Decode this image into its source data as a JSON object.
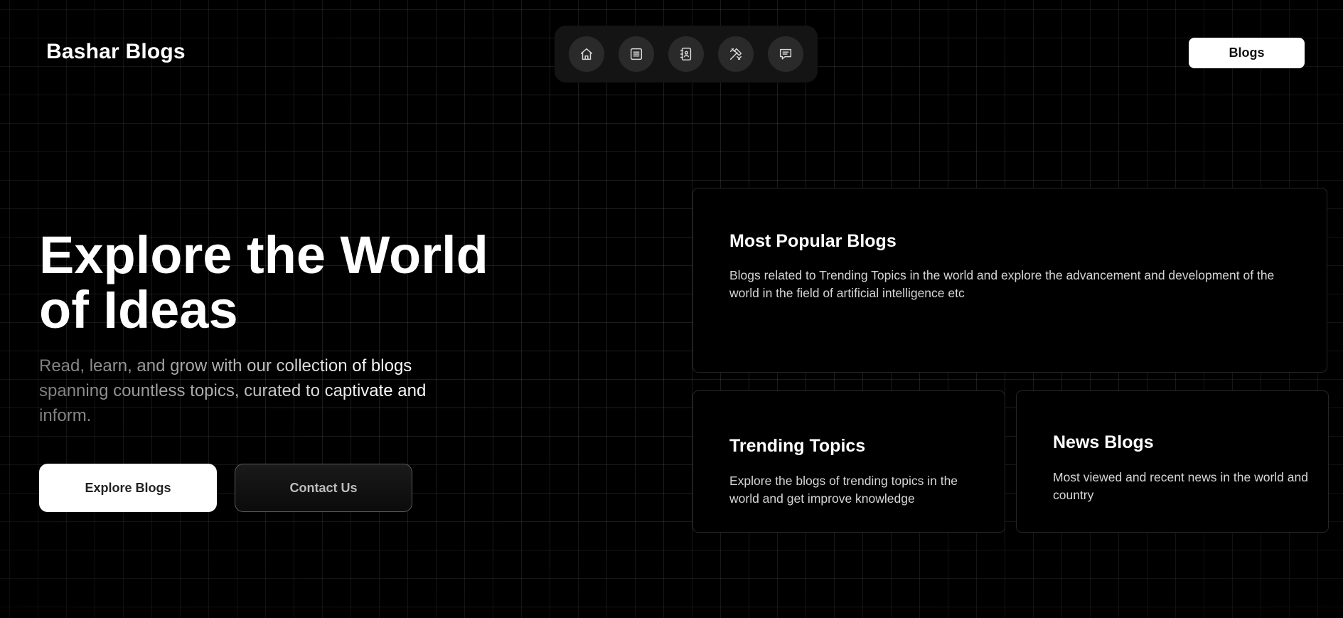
{
  "header": {
    "brand": "Bashar Blogs",
    "nav_icons": [
      "home-icon",
      "list-icon",
      "contacts-icon",
      "tools-icon",
      "chat-icon"
    ],
    "cta_label": "Blogs"
  },
  "hero": {
    "title_line1": "Explore the World",
    "title_line2": "of Ideas",
    "subtitle": "Read, learn, and grow with our collection of blogs spanning countless topics, curated to captivate and inform.",
    "primary_button": "Explore Blogs",
    "secondary_button": "Contact Us"
  },
  "cards": {
    "popular": {
      "title": "Most Popular Blogs",
      "text": "Blogs related to Trending Topics in the world and explore the advancement and development of the world in the field of artificial intelligence etc"
    },
    "trending": {
      "title": "Trending Topics",
      "text": "Explore the blogs of trending topics in the world and get improve knowledge"
    },
    "news": {
      "title": "News Blogs",
      "text": "Most viewed and recent news in the world and country"
    }
  },
  "colors": {
    "background": "#000000",
    "grid_line": "#1e1e1e",
    "dock": "#141414",
    "nav_button": "#2a2a2a",
    "primary_button": "#ffffff"
  }
}
